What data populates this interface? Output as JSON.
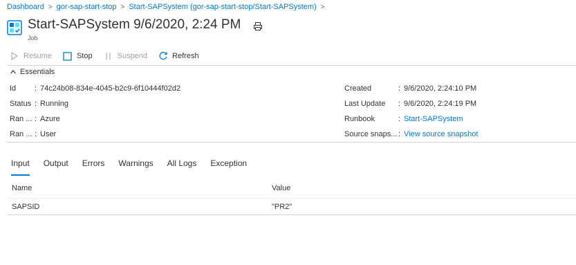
{
  "breadcrumb": {
    "items": [
      "Dashboard",
      "gor-sap-start-stop",
      "Start-SAPSystem (gor-sap-start-stop/Start-SAPSystem)"
    ]
  },
  "header": {
    "title": "Start-SAPSystem 9/6/2020, 2:24 PM",
    "subtitle": "Job"
  },
  "toolbar": {
    "resume": "Resume",
    "stop": "Stop",
    "suspend": "Suspend",
    "refresh": "Refresh"
  },
  "essentials": {
    "header": "Essentials",
    "left": [
      {
        "label": "Id",
        "value": "74c24b08-834e-4045-b2c9-6f10444f02d2"
      },
      {
        "label": "Status",
        "value": "Running"
      },
      {
        "label": "Ran ...",
        "value": "Azure"
      },
      {
        "label": "Ran ...",
        "value": "User"
      }
    ],
    "right": [
      {
        "label": "Created",
        "value": "9/6/2020, 2:24:10 PM"
      },
      {
        "label": "Last Update",
        "value": "9/6/2020, 2:24:19 PM"
      },
      {
        "label": "Runbook",
        "value": "Start-SAPSystem"
      },
      {
        "label": "Source snaps...",
        "value": "View source snapshot"
      }
    ]
  },
  "tabs": [
    "Input",
    "Output",
    "Errors",
    "Warnings",
    "All Logs",
    "Exception"
  ],
  "grid": {
    "headers": [
      "Name",
      "Value"
    ],
    "rows": [
      [
        "SAPSID",
        "\"PR2\""
      ]
    ]
  },
  "colors": {
    "accent": "#0078d4",
    "text": "#323130",
    "disabled": "#a19f9d",
    "border": "#d2d0ce"
  }
}
